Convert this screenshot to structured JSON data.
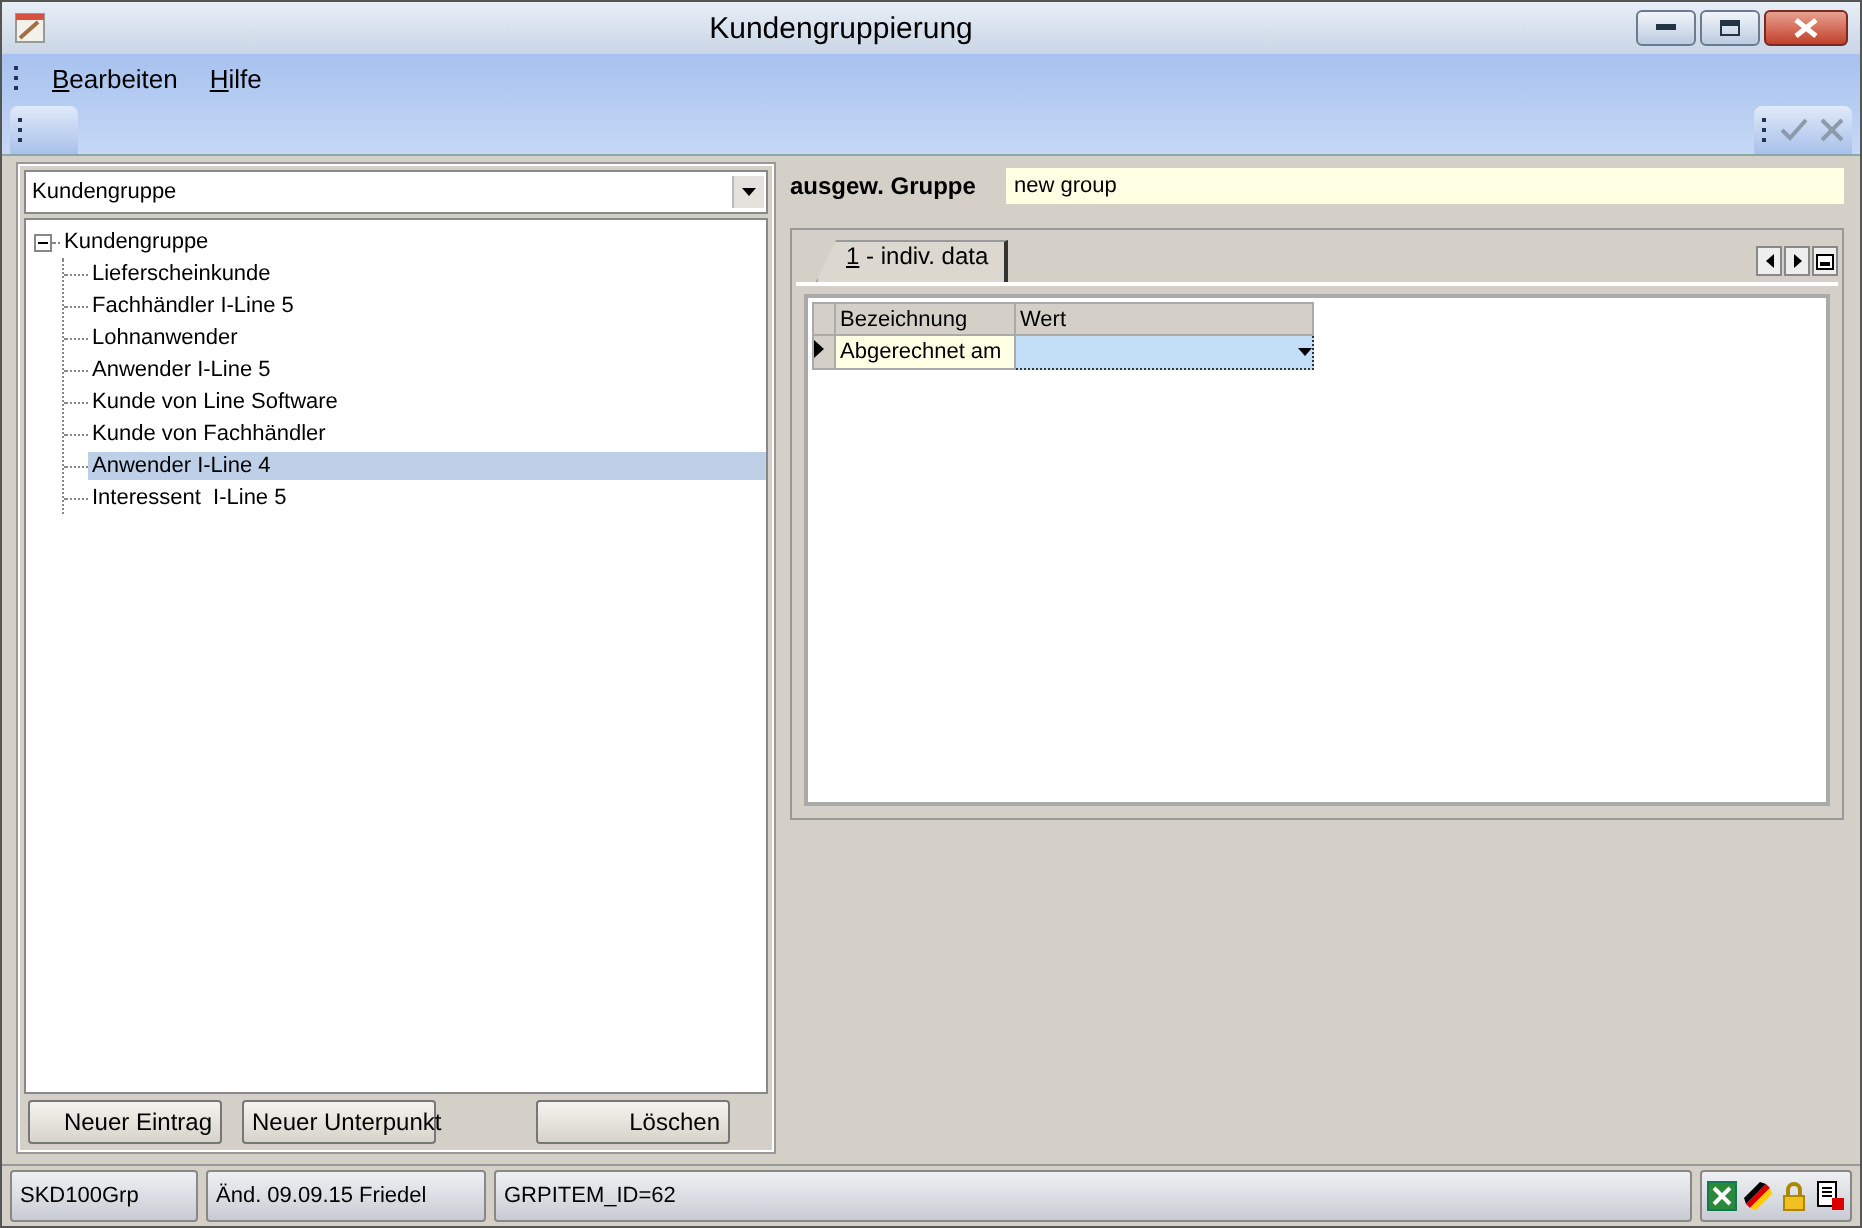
{
  "window": {
    "title": "Kundengruppierung"
  },
  "menu": [
    "Bearbeiten",
    "Hilfe"
  ],
  "group_select": {
    "value": "Kundengruppe"
  },
  "tree": [
    {
      "label": "Kundengruppe",
      "expanded": true,
      "selected": false,
      "children": [
        {
          "label": "Lieferscheinkunde",
          "selected": false
        },
        {
          "label": "Fachhändler I-Line 5",
          "selected": false
        },
        {
          "label": "Lohnanwender",
          "selected": false
        },
        {
          "label": "Anwender I-Line 5",
          "selected": false
        },
        {
          "label": "Kunde von Line Software",
          "selected": false
        },
        {
          "label": "Kunde von Fachhändler",
          "selected": false
        },
        {
          "label": "Anwender I-Line 4",
          "selected": true
        },
        {
          "label": "Interessent  I-Line 5",
          "selected": false
        }
      ]
    }
  ],
  "left_buttons": [
    "Neuer Eintrag",
    "Neuer Unterpunkt",
    "Löschen"
  ],
  "selected_group": {
    "label": "ausgew. Gruppe",
    "value": "new group"
  },
  "tabs": [
    {
      "label": "1 - indiv. data",
      "selected": true
    }
  ],
  "grid": {
    "columns": [
      "Bezeichnung",
      "Wert"
    ],
    "rows": [
      {
        "name": "Abgerechnet am",
        "value": "",
        "current": true
      }
    ]
  },
  "status_bar": [
    "SKD100Grp",
    "Änd. 09.09.15 Friedel",
    "GRPITEM_ID=62"
  ]
}
